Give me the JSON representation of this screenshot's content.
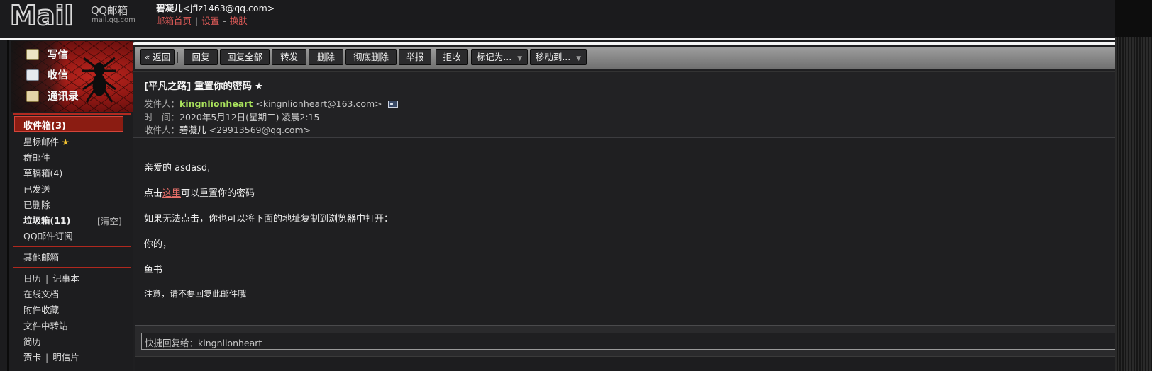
{
  "header": {
    "logo_text": "Mail",
    "brand_text": "QQ邮箱",
    "brand_domain": "mail.qq.com",
    "account_name": "碧凝儿",
    "account_email": "<jflz1463@qq.com>",
    "link_home": "邮箱首页",
    "link_divider": "|",
    "link_settings": "设置",
    "link_dash": "-",
    "link_skin": "换肤"
  },
  "sidebar": {
    "quick": {
      "write": "写信",
      "receive": "收信",
      "contacts": "通讯录"
    },
    "folders": {
      "inbox": "收件箱(3)",
      "starred": "星标邮件",
      "starred_mark": "★",
      "group": "群邮件",
      "drafts": "草稿箱(4)",
      "sent": "已发送",
      "deleted": "已删除",
      "spam": "垃圾箱(11)",
      "spam_clear": "[清空]",
      "subscriptions": "QQ邮件订阅",
      "other_mail": "其他邮箱",
      "calendar": "日历",
      "notes": "记事本",
      "online_docs": "在线文档",
      "attachments": "附件收藏",
      "file_transfer": "文件中转站",
      "resume": "简历",
      "cards": "贺卡",
      "postcards": "明信片",
      "pipe": "|"
    }
  },
  "toolbar": {
    "back": "« 返回",
    "reply": "回复",
    "reply_all": "回复全部",
    "forward": "转发",
    "delete": "删除",
    "delete_permanent": "彻底删除",
    "report": "举报",
    "reject": "拒收",
    "mark_as": "标记为...",
    "move_to": "移动到...",
    "caret": "▼"
  },
  "mail": {
    "subject": "[平凡之路] 重置你的密码",
    "subject_star": "★",
    "from_label": "发件人：",
    "from_name": "kingnlionheart",
    "from_addr": "<kingnlionheart@163.com>",
    "time_label": "时　间：",
    "time_value": "2020年5月12日(星期二) 凌晨2:15",
    "to_label": "收件人：",
    "to_name": "碧凝儿",
    "to_addr": "<29913569@qq.com>",
    "body": {
      "greeting": "亲爱的 asdasd,",
      "click_prefix": "点击",
      "click_link": "这里",
      "click_suffix": "可以重置你的密码",
      "copy_hint": "如果无法点击，你也可以将下面的地址复制到浏览器中打开：",
      "yours": "你的，",
      "signature": "鱼书",
      "note": "注意，请不要回复此邮件哦"
    },
    "quick_reply": "快捷回复给：kingnlionheart"
  },
  "colors": {
    "accent_red": "#8b1c12",
    "link_red": "#e05b58",
    "sender_green": "#a9e25c",
    "background": "#1c1c1e"
  }
}
